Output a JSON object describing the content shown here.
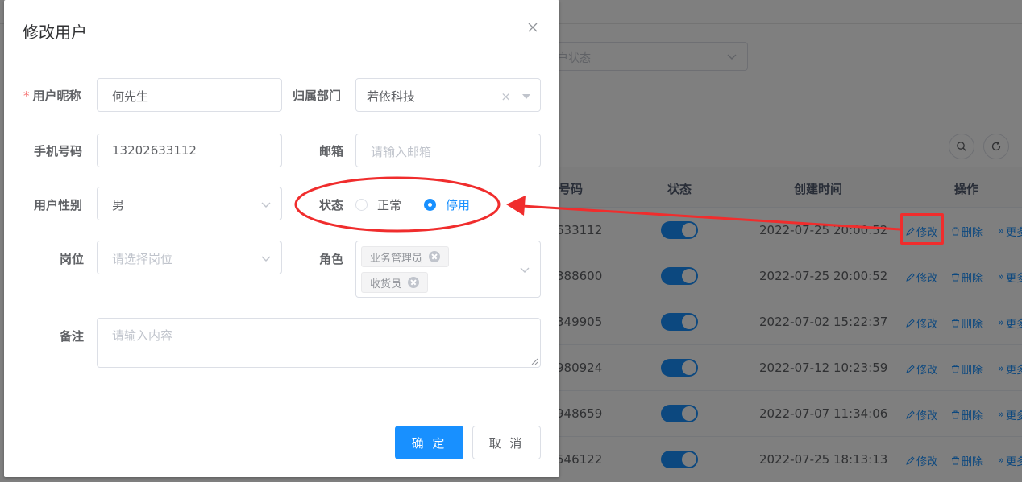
{
  "background": {
    "filter_placeholder_fragment": "户状态",
    "table": {
      "headers": {
        "phone": "号码",
        "status": "状态",
        "created": "创建时间",
        "actions": "操作"
      },
      "rows": [
        {
          "phone": "633112",
          "created": "2022-07-25 20:00:52"
        },
        {
          "phone": "388600",
          "created": "2022-07-25 20:00:52"
        },
        {
          "phone": "349905",
          "created": "2022-07-02 15:22:37"
        },
        {
          "phone": "980924",
          "created": "2022-07-12 10:23:59"
        },
        {
          "phone": "948659",
          "created": "2022-07-07 11:34:06"
        },
        {
          "phone": "546122",
          "created": "2022-07-25 18:13:13"
        }
      ],
      "action_labels": {
        "edit": "修改",
        "delete": "删除",
        "more": "更多"
      }
    }
  },
  "dialog": {
    "title": "修改用户",
    "required_mark": "*",
    "fields": {
      "nickname": {
        "label": "用户昵称",
        "value": "何先生"
      },
      "dept": {
        "label": "归属部门",
        "value": "若依科技",
        "clear": "×"
      },
      "phone": {
        "label": "手机号码",
        "value": "13202633112"
      },
      "email": {
        "label": "邮箱",
        "placeholder": "请输入邮箱"
      },
      "gender": {
        "label": "用户性别",
        "value": "男"
      },
      "status": {
        "label": "状态",
        "options": [
          "正常",
          "停用"
        ],
        "selected": "停用"
      },
      "post": {
        "label": "岗位",
        "placeholder": "请选择岗位"
      },
      "role": {
        "label": "角色",
        "tags": [
          "业务管理员",
          "收货员"
        ]
      },
      "remark": {
        "label": "备注",
        "placeholder": "请输入内容"
      }
    },
    "buttons": {
      "confirm": "确 定",
      "cancel": "取 消"
    }
  },
  "colors": {
    "primary": "#1890ff",
    "annotation": "#f02d2d",
    "required": "#f56c6c"
  }
}
